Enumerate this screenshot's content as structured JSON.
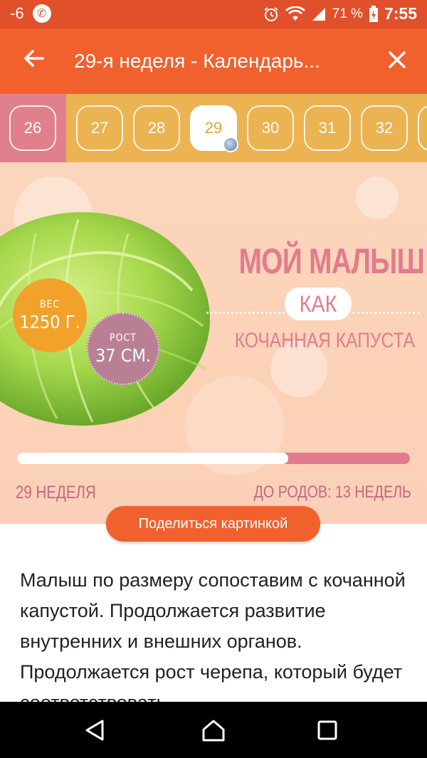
{
  "status_bar": {
    "notif_text": "-6",
    "battery": "71 %",
    "time": "7:55"
  },
  "app_bar": {
    "title": "29-я неделя - Календарь...",
    "back_icon": "arrow-left-icon",
    "close_icon": "close-icon"
  },
  "weeks": {
    "items": [
      "26",
      "27",
      "28",
      "29",
      "30",
      "31",
      "32"
    ],
    "current": "29"
  },
  "hero": {
    "headline_line1": "МОЙ МАЛЫШ",
    "headline_kak": "КАК",
    "headline_line3": "КОЧАННАЯ КАПУСТА",
    "weight_label": "ВЕС",
    "weight_value": "1250 Г.",
    "height_label": "РОСТ",
    "height_value": "37 СМ.",
    "progress_fraction": 0.69,
    "week_label": "29 НЕДЕЛЯ",
    "due_label": "ДО РОДОВ: 13 НЕДЕЛЬ"
  },
  "share_button": "Поделиться картинкой",
  "description": "Малыш по размеру сопоставим с кочанной капустой. Продолжается развитие внутренних и внешних органов. Продолжается рост черепа, который будет соответствовать",
  "colors": {
    "accent": "#f0612e",
    "week_strip": "#ecb352",
    "past_week": "#e0808a",
    "pink_text": "#e27b8e"
  }
}
